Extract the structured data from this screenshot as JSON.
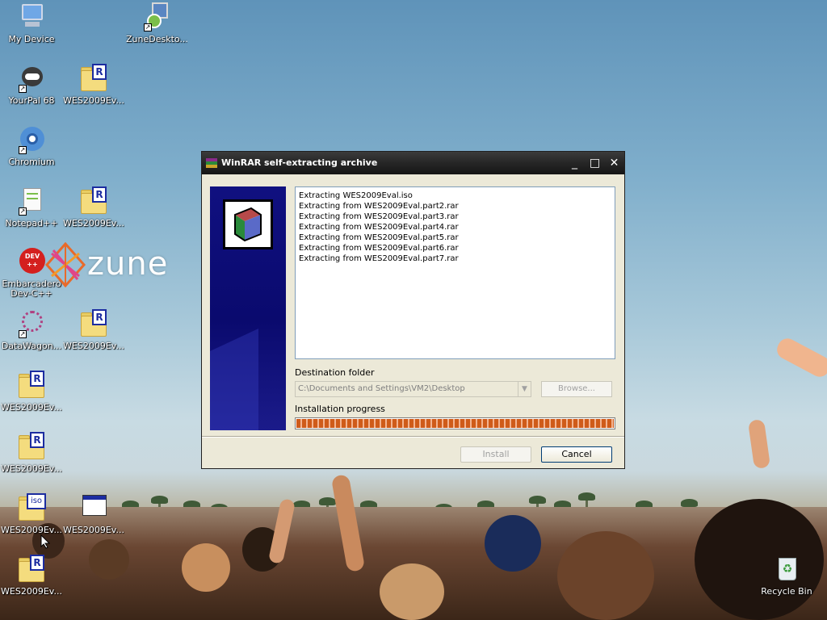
{
  "desktop": {
    "icons": [
      {
        "label": "My Device",
        "icon": "computer-icon"
      },
      {
        "label": "ZuneDeskto...",
        "icon": "zune-installer-icon"
      },
      {
        "label": "YourPal 68",
        "icon": "raccoon-icon"
      },
      {
        "label": "WES2009Ev...",
        "icon": "rar-folder-icon"
      },
      {
        "label": "Chromium",
        "icon": "chromium-icon"
      },
      {
        "label": "Notepad++",
        "icon": "notepad-plus-plus-icon"
      },
      {
        "label": "WES2009Ev...",
        "icon": "rar-folder-icon"
      },
      {
        "label": "Embarcadero Dev-C++",
        "icon": "devcpp-icon"
      },
      {
        "label": "DataWagon...",
        "icon": "datawagon-icon"
      },
      {
        "label": "WES2009Ev...",
        "icon": "rar-folder-icon"
      },
      {
        "label": "WES2009Ev...",
        "icon": "rar-folder-icon"
      },
      {
        "label": "WES2009Ev...",
        "icon": "rar-folder-icon"
      },
      {
        "label": "WES2009Ev...",
        "icon": "iso-folder-icon"
      },
      {
        "label": "WES2009Ev...",
        "icon": "window-file-icon"
      },
      {
        "label": "WES2009Ev...",
        "icon": "rar-folder-icon"
      },
      {
        "label": "Recycle Bin",
        "icon": "recycle-bin-icon"
      }
    ],
    "wallpaper_logo": "zune",
    "devcpp_badge": "DEV\n++"
  },
  "window": {
    "title": "WinRAR self-extracting archive",
    "title_buttons": {
      "minimize": "_",
      "maximize": "□",
      "close": "✕"
    },
    "log_lines": [
      "Extracting WES2009Eval.iso",
      "Extracting from WES2009Eval.part2.rar",
      "Extracting from WES2009Eval.part3.rar",
      "Extracting from WES2009Eval.part4.rar",
      "Extracting from WES2009Eval.part5.rar",
      "Extracting from WES2009Eval.part6.rar",
      "Extracting from WES2009Eval.part7.rar"
    ],
    "destination_label": "Destination folder",
    "destination_value": "C:\\Documents and Settings\\VM2\\Desktop",
    "browse_label": "Browse...",
    "progress_label": "Installation progress",
    "progress_fraction": 1.0,
    "install_label": "Install",
    "cancel_label": "Cancel"
  },
  "colors": {
    "titlebar": "#262626",
    "side_panel": "#0a0a6e",
    "progress": "#cf5b19"
  }
}
